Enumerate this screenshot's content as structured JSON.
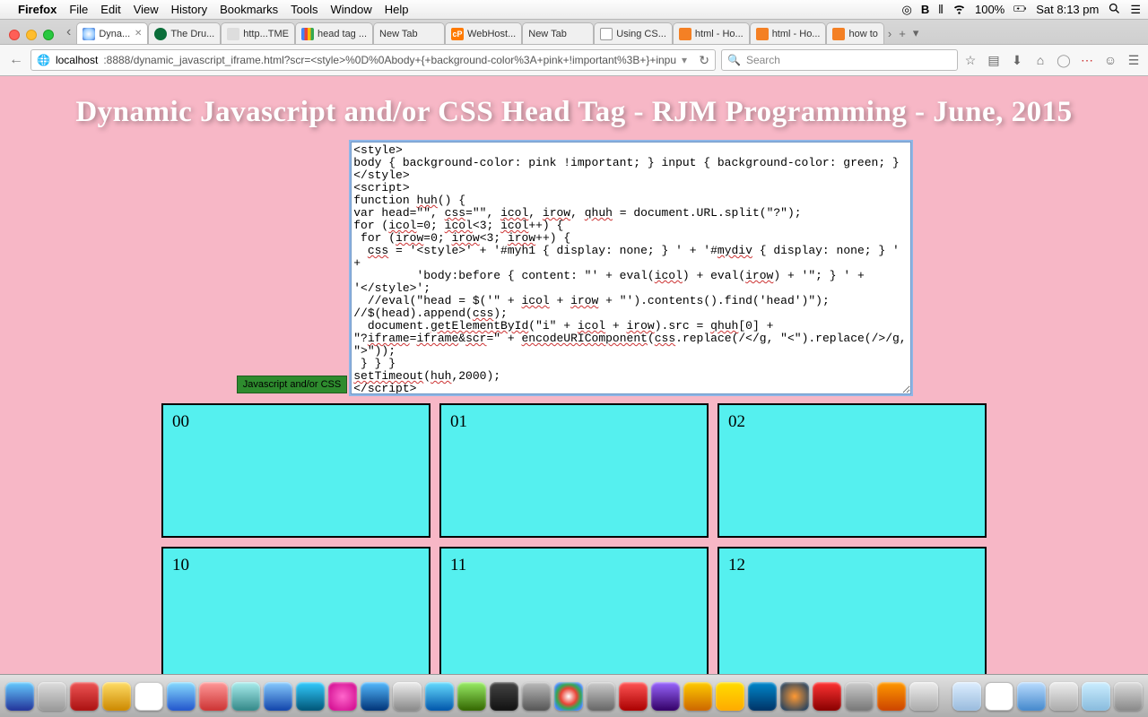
{
  "menubar": {
    "apple": "",
    "app": "Firefox",
    "items": [
      "File",
      "Edit",
      "View",
      "History",
      "Bookmarks",
      "Tools",
      "Window",
      "Help"
    ],
    "battery": "100%",
    "clock": "Sat 8:13 pm"
  },
  "tabs": [
    {
      "label": "Dyna...",
      "active": true
    },
    {
      "label": "The Dru..."
    },
    {
      "label": "http...TME"
    },
    {
      "label": "head tag ..."
    },
    {
      "label": "New Tab"
    },
    {
      "label": "WebHost..."
    },
    {
      "label": "New Tab"
    },
    {
      "label": "Using CS..."
    },
    {
      "label": "html - Ho..."
    },
    {
      "label": "html - Ho..."
    },
    {
      "label": "how to"
    }
  ],
  "url": {
    "host": "localhost",
    "rest": ":8888/dynamic_javascript_iframe.html?scr=<style>%0D%0Abody+{+background-color%3A+pink+!important%3B+}+inpu",
    "dropdown": "▾"
  },
  "search": {
    "placeholder": "Search"
  },
  "page": {
    "title": "Dynamic Javascript and/or CSS Head Tag - RJM Programming - June, 2015",
    "button_label": "Javascript and/or CSS",
    "code": "<style>\nbody { background-color: pink !important; } input { background-color: green; }\n</style>\n<script>\nfunction huh() {\nvar head=\"\", css=\"\", icol, irow, qhuh = document.URL.split(\"?\");\nfor (icol=0; icol<3; icol++) {\n for (irow=0; irow<3; irow++) {\n  css = '<style>' + '#myh1 { display: none; } ' + '#mydiv { display: none; } '\n+\n         'body:before { content: \"' + eval(icol) + eval(irow) + '\"; } ' +\n'</style>';\n  //eval(\"head = $('\" + icol + irow + \"').contents().find('head')\");\n//$(head).append(css);\n  document.getElementById(\"i\" + icol + irow).src = qhuh[0] +\n\"?iframe=iframe&scr=\" + encodeURIComponent(css.replace(/</g, \"<\").replace(/>/g,\n\">\"));\n } } }\nsetTimeout(huh,2000);\n</script>",
    "cells": [
      "00",
      "01",
      "02",
      "10",
      "11",
      "12"
    ]
  }
}
